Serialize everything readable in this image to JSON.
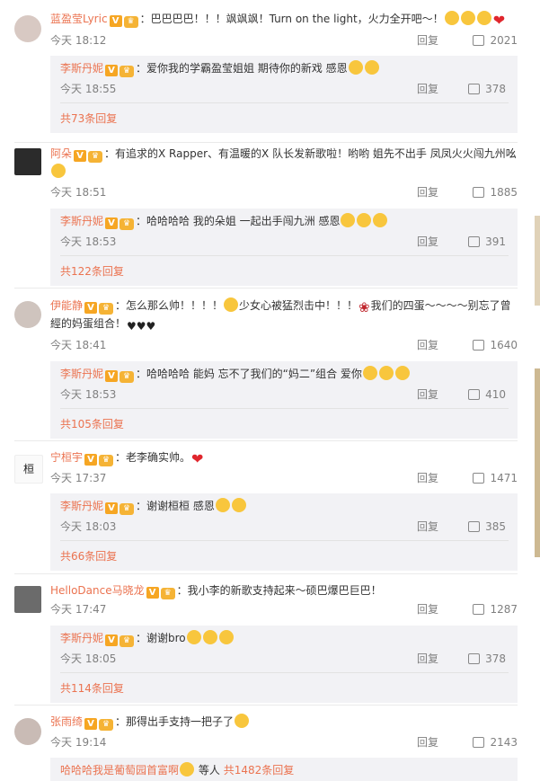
{
  "comments": [
    {
      "user": "蓝盈莹Lyric",
      "text": "：巴巴巴巴！！！飒飒飒！Turn on the light，火力全开吧～！",
      "time": "今天 18:12",
      "reply_label": "回复",
      "likes": "2021",
      "sub": {
        "user": "李斯丹妮",
        "text": "：爱你我的学霸盈莹姐姐 期待你的新戏 感恩",
        "time": "今天 18:55",
        "reply_label": "回复",
        "likes": "378",
        "more": "共73条回复"
      }
    },
    {
      "user": "阿朵",
      "text": "：有追求的X Rapper、有温暖的X 队长发新歌啦！哟哟 姐先不出手 凤凤火火闯九州吆",
      "time": "今天 18:51",
      "reply_label": "回复",
      "likes": "1885",
      "sub": {
        "user": "李斯丹妮",
        "text": "：哈哈哈哈 我的朵姐 一起出手闯九洲 感恩",
        "time": "今天 18:53",
        "reply_label": "回复",
        "likes": "391",
        "more": "共122条回复"
      }
    },
    {
      "user": "伊能静",
      "text": "：怎么那么帅！！！！",
      "text2": "少女心被猛烈击中！！！",
      "text3": "我们的四蛋～～～～别忘了曾經的妈蛋组合！",
      "time": "今天 18:41",
      "reply_label": "回复",
      "likes": "1640",
      "sub": {
        "user": "李斯丹妮",
        "text": "：哈哈哈哈 能妈 忘不了我们的“妈二”组合 爱你",
        "time": "今天 18:53",
        "reply_label": "回复",
        "likes": "410",
        "more": "共105条回复"
      }
    },
    {
      "user": "宁桓宇",
      "avatar_text": "桓",
      "text": "：老李确实帅。",
      "time": "今天 17:37",
      "reply_label": "回复",
      "likes": "1471",
      "sub": {
        "user": "李斯丹妮",
        "text": "：谢谢桓桓 感恩",
        "time": "今天 18:03",
        "reply_label": "回复",
        "likes": "385",
        "more": "共66条回复"
      }
    },
    {
      "user": "HelloDance马晓龙",
      "text": "：我小李的新歌支持起来～硕巴爆巴巨巴！",
      "time": "今天 17:47",
      "reply_label": "回复",
      "likes": "1287",
      "sub": {
        "user": "李斯丹妮",
        "text": "：谢谢bro",
        "time": "今天 18:05",
        "reply_label": "回复",
        "likes": "378",
        "more": "共114条回复"
      }
    },
    {
      "user": "张雨绮",
      "text": "：那得出手支持一把子了",
      "time": "今天 19:14",
      "reply_label": "回复",
      "likes": "2143",
      "sub": {
        "user": "哈哈哈我是葡萄园首富啊",
        "text": "等人",
        "more": "共1482条回复"
      }
    }
  ],
  "badge_v": "V",
  "icons": {
    "like": "thumbs-up-icon",
    "heart": "heart-emoji",
    "rose": "rose-emoji"
  },
  "colors": {
    "name": "#eb7350",
    "meta": "#808080",
    "sub_bg": "#f2f2f5"
  }
}
